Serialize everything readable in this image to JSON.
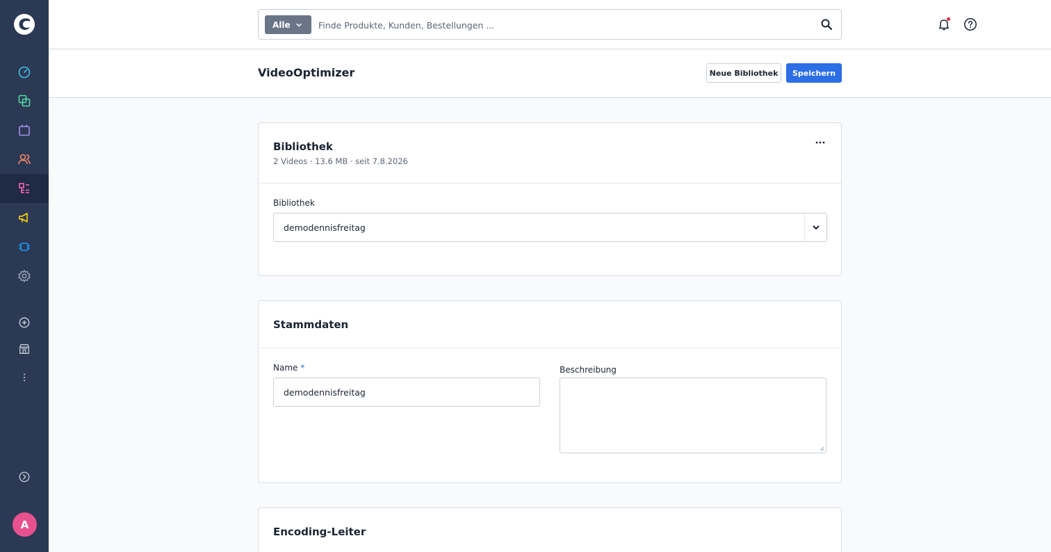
{
  "topbar": {
    "search_type": "Alle",
    "search_placeholder": "Finde Produkte, Kunden, Bestellungen ..."
  },
  "page": {
    "title": "VideoOptimizer",
    "btn_new_library": "Neue Bibliothek",
    "btn_save": "Speichern"
  },
  "library_card": {
    "title": "Bibliothek",
    "meta": "2 Videos · 13.6 MB · seit 7.8.2026",
    "select_label": "Bibliothek",
    "select_value": "demodennisfreitag"
  },
  "master_card": {
    "title": "Stammdaten",
    "name_label": "Name",
    "name_required": "*",
    "name_value": "demodennisfreitag",
    "description_label": "Beschreibung",
    "description_value": ""
  },
  "encoding_card": {
    "title": "Encoding-Leiter"
  },
  "user": {
    "avatar_initial": "A"
  },
  "colors": {
    "sidebar": "#2c3955",
    "primary": "#2b6ee5",
    "avatar": "#e8518f"
  },
  "sidebar_icons": [
    "dashboard-icon",
    "catalog-icon",
    "orders-icon",
    "customers-icon",
    "content-icon",
    "marketing-icon",
    "extensions-icon",
    "settings-icon",
    "add-icon",
    "sales-channel-icon",
    "more-icon",
    "expand-icon"
  ]
}
